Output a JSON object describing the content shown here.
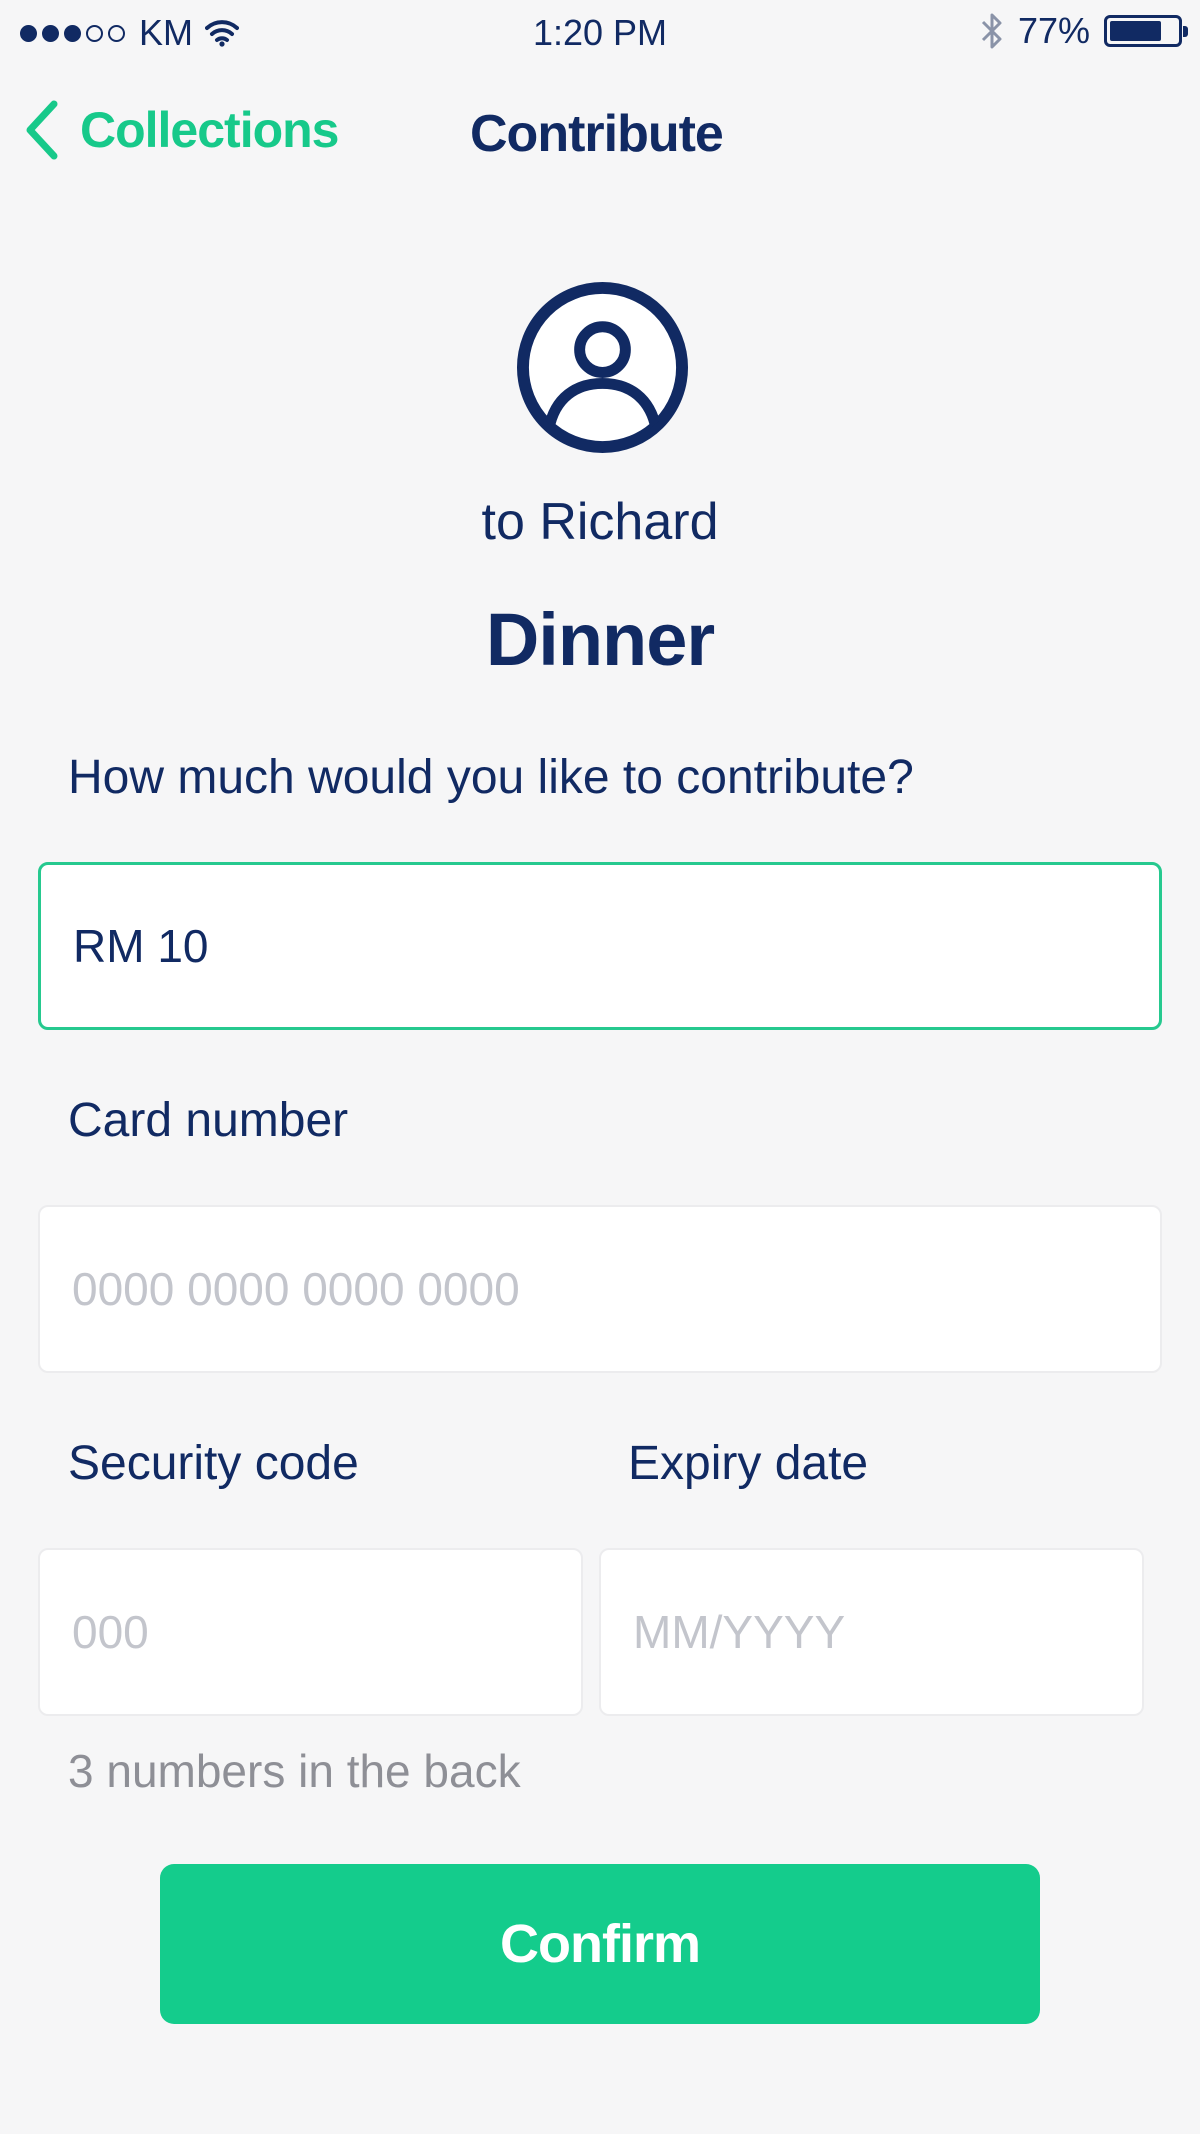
{
  "status_bar": {
    "carrier": "KM",
    "time": "1:20 PM",
    "battery": "77%",
    "battery_level": 0.77,
    "signal_bars": 3,
    "signal_total": 5
  },
  "nav": {
    "back_label": "Collections",
    "title": "Contribute"
  },
  "recipient": {
    "text": "to Richard",
    "icon": "user-circle-icon"
  },
  "collection": {
    "title": "Dinner"
  },
  "form": {
    "amount_label": "How much would you like to contribute?",
    "amount_value": "RM 10",
    "card_label": "Card number",
    "card_placeholder": "0000 0000 0000 0000",
    "security_label": "Security code",
    "security_placeholder": "000",
    "expiry_label": "Expiry date",
    "expiry_placeholder": "MM/YYYY",
    "security_hint": "3 numbers in the back",
    "confirm_label": "Confirm"
  },
  "colors": {
    "accent": "#14cc8c",
    "text": "#112a63",
    "background": "#f6f6f7"
  }
}
